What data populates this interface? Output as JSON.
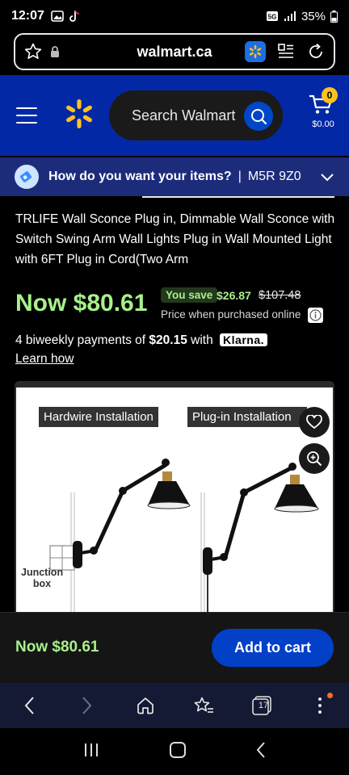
{
  "status": {
    "time": "12:07",
    "battery": "35%"
  },
  "browser": {
    "url": "walmart.ca",
    "tab_count": "17"
  },
  "header": {
    "search_placeholder": "Search Walmart",
    "cart_count": "0",
    "cart_total": "$0.00"
  },
  "delivery": {
    "question": "How do you want your items?",
    "separator": "|",
    "postal": "M5R 9Z0"
  },
  "product": {
    "title": "TRLIFE Wall Sconce Plug in, Dimmable Wall Sconce with Switch Swing Arm Wall Lights Plug in Wall Mounted Light with 6FT Plug in Cord(Two Arm",
    "price_now": "Now $80.61",
    "you_save_label": "You save",
    "you_save_amount": "$26.87",
    "was_price": "$107.48",
    "price_note": "Price when purchased online",
    "biweekly_prefix": "4 biweekly payments of ",
    "biweekly_amount": "$20.15",
    "biweekly_suffix": " with ",
    "klarna": "Klarna.",
    "learn_how": "Learn how",
    "image": {
      "label_left": "Hardwire Installation",
      "label_right": "Plug-in Installation",
      "junction_label_line1": "Junction",
      "junction_label_line2": "box"
    }
  },
  "sticky": {
    "price": "Now $80.61",
    "add_to_cart": "Add to cart"
  },
  "colors": {
    "walmart_blue": "#0328a6",
    "price_green": "#a8f08a",
    "spark_yellow": "#ffc220",
    "button_blue": "#0340c8"
  }
}
